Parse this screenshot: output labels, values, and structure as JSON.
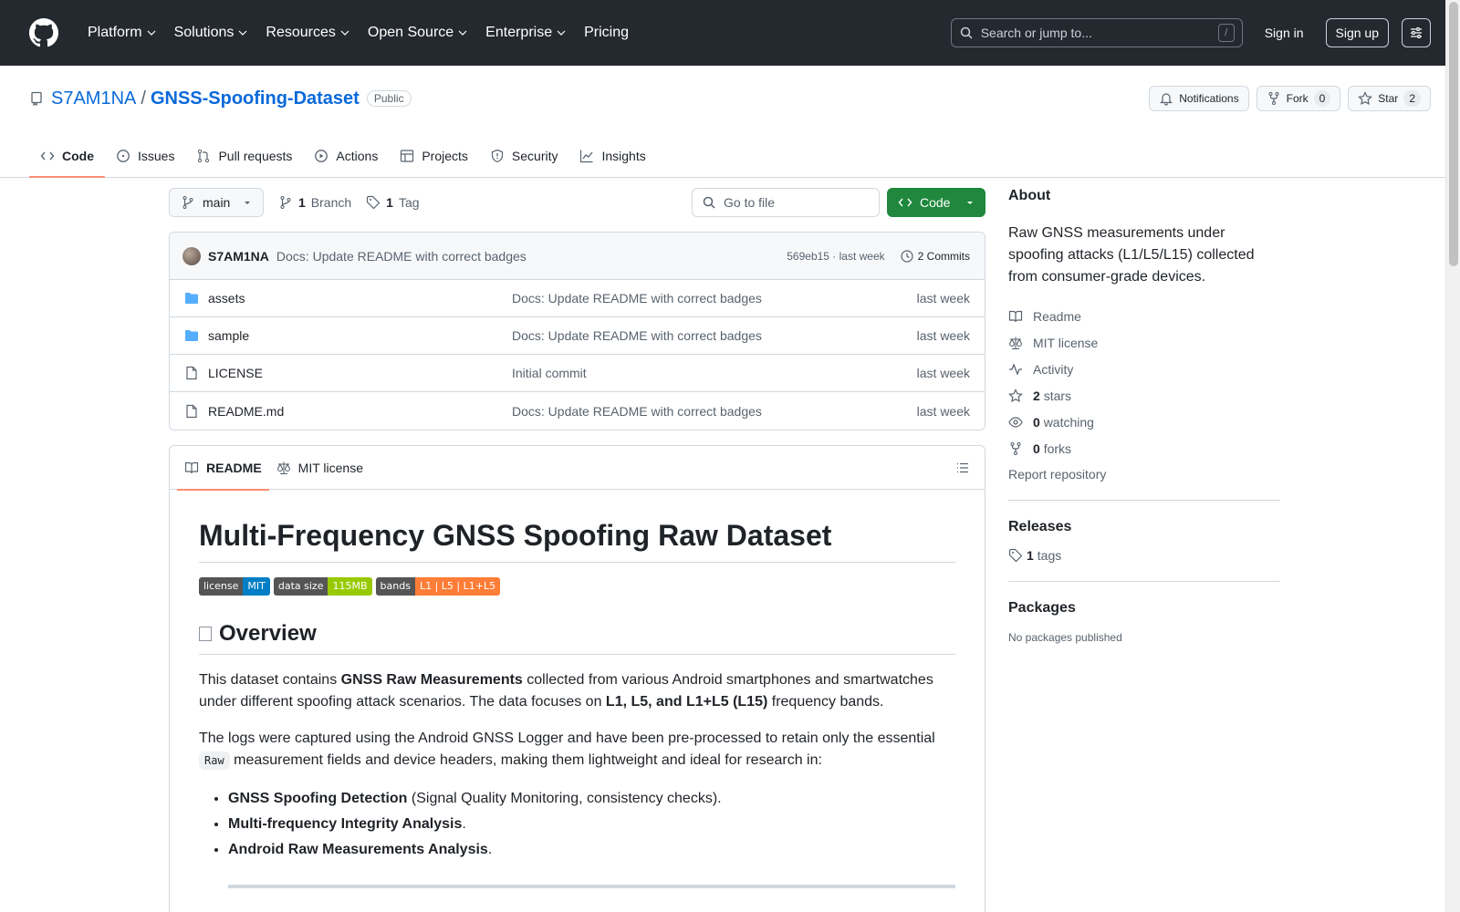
{
  "header": {
    "nav": [
      "Platform",
      "Solutions",
      "Resources",
      "Open Source",
      "Enterprise",
      "Pricing"
    ],
    "search_placeholder": "Search or jump to...",
    "search_shortcut": "/",
    "sign_in": "Sign in",
    "sign_up": "Sign up"
  },
  "repo": {
    "owner": "S7AM1NA",
    "sep": "/",
    "name": "GNSS-Spoofing-Dataset",
    "visibility": "Public",
    "notifications": "Notifications",
    "fork_label": "Fork",
    "fork_count": "0",
    "star_label": "Star",
    "star_count": "2",
    "tabs": [
      "Code",
      "Issues",
      "Pull requests",
      "Actions",
      "Projects",
      "Security",
      "Insights"
    ]
  },
  "filenav": {
    "branch": "main",
    "branch_count": "1",
    "branch_label": "Branch",
    "tag_count": "1",
    "tag_label": "Tag",
    "goto_placeholder": "Go to file",
    "code_button": "Code"
  },
  "latest_commit": {
    "author": "S7AM1NA",
    "message": "Docs: Update README with correct badges",
    "hash_time": "569eb15 · last week",
    "commits": "2 Commits"
  },
  "files": [
    {
      "name": "assets",
      "type": "folder",
      "commit": "Docs: Update README with correct badges",
      "date": "last week"
    },
    {
      "name": "sample",
      "type": "folder",
      "commit": "Docs: Update README with correct badges",
      "date": "last week"
    },
    {
      "name": "LICENSE",
      "type": "file",
      "commit": "Initial commit",
      "date": "last week"
    },
    {
      "name": "README.md",
      "type": "file",
      "commit": "Docs: Update README with correct badges",
      "date": "last week"
    }
  ],
  "readme": {
    "tab_readme": "README",
    "tab_license": "MIT license",
    "title": "Multi-Frequency GNSS Spoofing Raw Dataset",
    "badges": [
      {
        "key": "license",
        "value": "MIT",
        "color": "#007ec6"
      },
      {
        "key": "data size",
        "value": "115MB",
        "color": "#97ca00"
      },
      {
        "key": "bands",
        "value": "L1 | L5 | L1+L5",
        "color": "#fe7d37"
      }
    ],
    "overview": "Overview",
    "p1_a": "This dataset contains ",
    "p1_b": "GNSS Raw Measurements",
    "p1_c": " collected from various Android smartphones and smartwatches under different spoofing attack scenarios. The data focuses on ",
    "p1_d": "L1, L5, and L1+L5 (L15)",
    "p1_e": " frequency bands.",
    "p2_a": "The logs were captured using the Android GNSS Logger and have been pre-processed to retain only the essential ",
    "p2_code": "Raw",
    "p2_b": " measurement fields and device headers, making them lightweight and ideal for research in:",
    "list": [
      {
        "bold": "GNSS Spoofing Detection",
        "rest": " (Signal Quality Monitoring, consistency checks)."
      },
      {
        "bold": "Multi-frequency Integrity Analysis",
        "rest": "."
      },
      {
        "bold": "Android Raw Measurements Analysis",
        "rest": "."
      }
    ]
  },
  "sidebar": {
    "about": "About",
    "description": "Raw GNSS measurements under spoofing attacks (L1/L5/L15) collected from consumer-grade devices.",
    "readme": "Readme",
    "license": "MIT license",
    "activity": "Activity",
    "stars_count": "2",
    "stars_label": "stars",
    "watching_count": "0",
    "watching_label": "watching",
    "forks_count": "0",
    "forks_label": "forks",
    "report": "Report repository",
    "releases": "Releases",
    "tags_count": "1",
    "tags_label": "tags",
    "packages": "Packages",
    "no_packages": "No packages published"
  }
}
